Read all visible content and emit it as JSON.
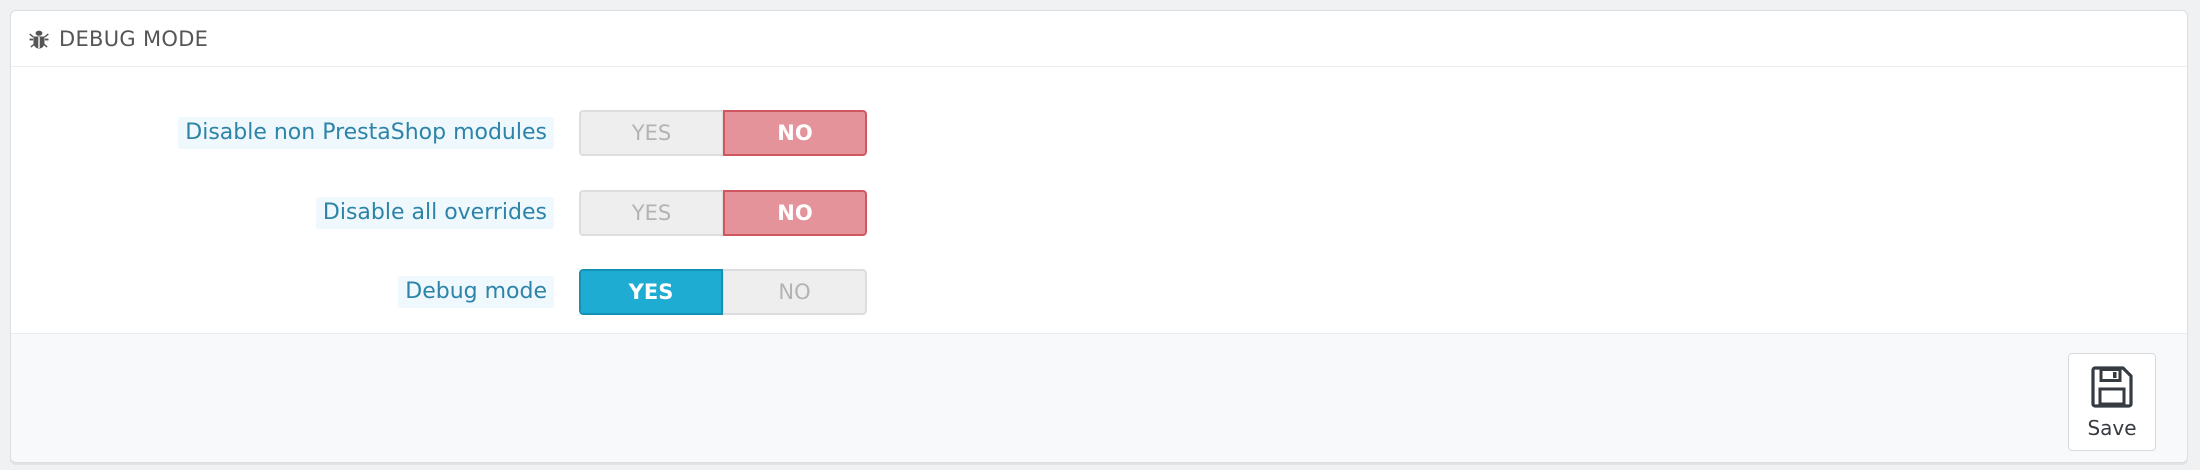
{
  "panel": {
    "title": "DEBUG MODE",
    "icon": "bug-icon"
  },
  "options": [
    {
      "label": "Disable non PrestaShop modules",
      "yes_label": "YES",
      "no_label": "NO",
      "selected": "NO"
    },
    {
      "label": "Disable all overrides",
      "yes_label": "YES",
      "no_label": "NO",
      "selected": "NO"
    },
    {
      "label": "Debug mode",
      "yes_label": "YES",
      "no_label": "NO",
      "selected": "YES"
    }
  ],
  "footer": {
    "save_label": "Save",
    "save_icon": "floppy-disk-icon"
  },
  "colors": {
    "label_text": "#2d84a8",
    "no_active": "#e4939a",
    "yes_active": "#1eacd2",
    "inactive": "#eeeeee"
  }
}
